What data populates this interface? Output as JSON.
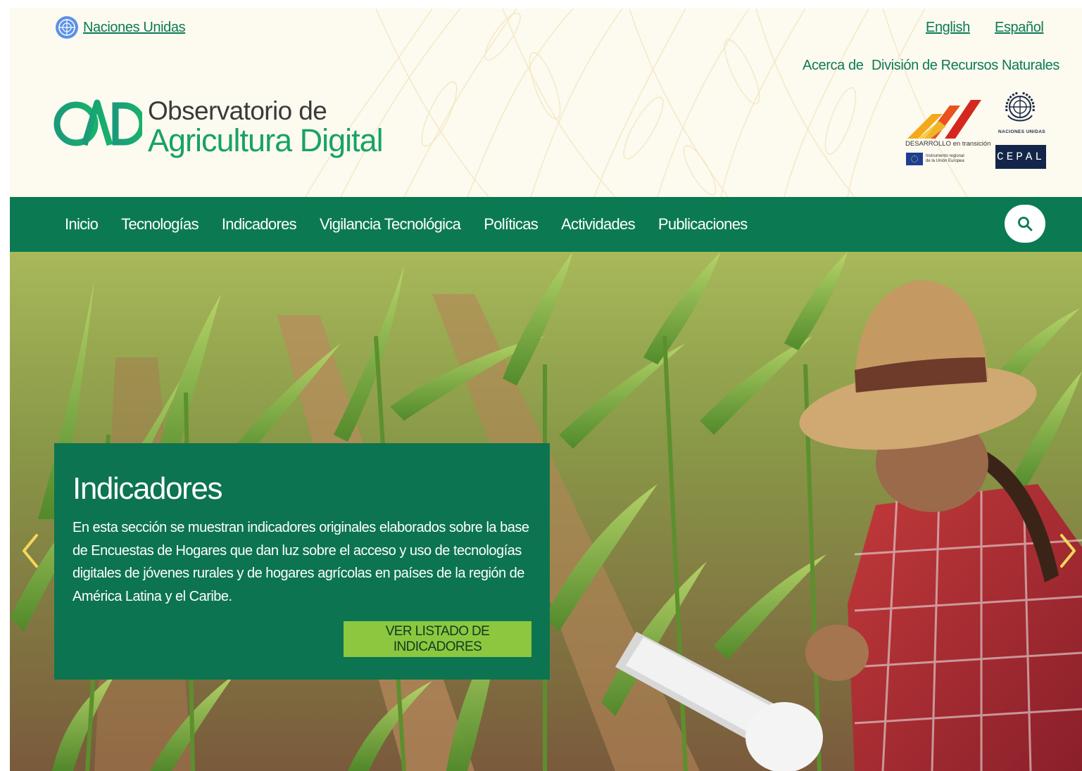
{
  "top_links": {
    "un_link": "Naciones Unidas",
    "lang_english": "English",
    "lang_spanish": "Español",
    "about": "Acerca de",
    "division": "División de Recursos Naturales"
  },
  "logo": {
    "line1": "Observatorio de",
    "line2": "Agricultura Digital"
  },
  "partners": {
    "dit_caption": "DESARROLLO en transición",
    "eu_caption": "Instrumento regional de la Unión Europea",
    "un_caption": "NACIONES UNIDAS",
    "cepal": "CEPAL"
  },
  "nav": {
    "items": [
      "Inicio",
      "Tecnologías",
      "Indicadores",
      "Vigilancia Tecnológica",
      "Políticas",
      "Actividades",
      "Publicaciones"
    ]
  },
  "hero": {
    "title": "Indicadores",
    "text": "En esta sección se muestran indicadores originales elaborados sobre la base de Encuestas de Hogares que dan luz sobre el acceso y uso de tecnologías digitales de jóvenes rurales y de hogares agrícolas en países de la región de América Latina y el Caribe.",
    "button": "VER LISTADO DE INDICADORES"
  },
  "colors": {
    "brand_green": "#0b7a52",
    "logo_green": "#17a268",
    "button_green": "#8dc73f",
    "header_bg": "#fdfaf0"
  },
  "icons": [
    "un-globe-icon",
    "search-icon",
    "chevron-left-icon",
    "chevron-right-icon",
    "un-emblem-icon",
    "eu-flag-icon"
  ]
}
